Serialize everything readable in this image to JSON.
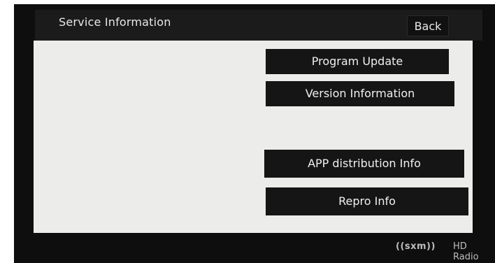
{
  "header": {
    "title": "Service Information",
    "back_label": "Back"
  },
  "menu": {
    "items": [
      {
        "label": "Program Update"
      },
      {
        "label": "Version Information"
      },
      {
        "label": "APP distribution Info"
      },
      {
        "label": "Repro Info"
      }
    ]
  },
  "branding": {
    "sxm": "((sxm))",
    "hd_radio": "HD Radio"
  },
  "colors": {
    "screen_background": "#ececea",
    "button_background": "#151515",
    "bezel": "#0e0e0e"
  }
}
